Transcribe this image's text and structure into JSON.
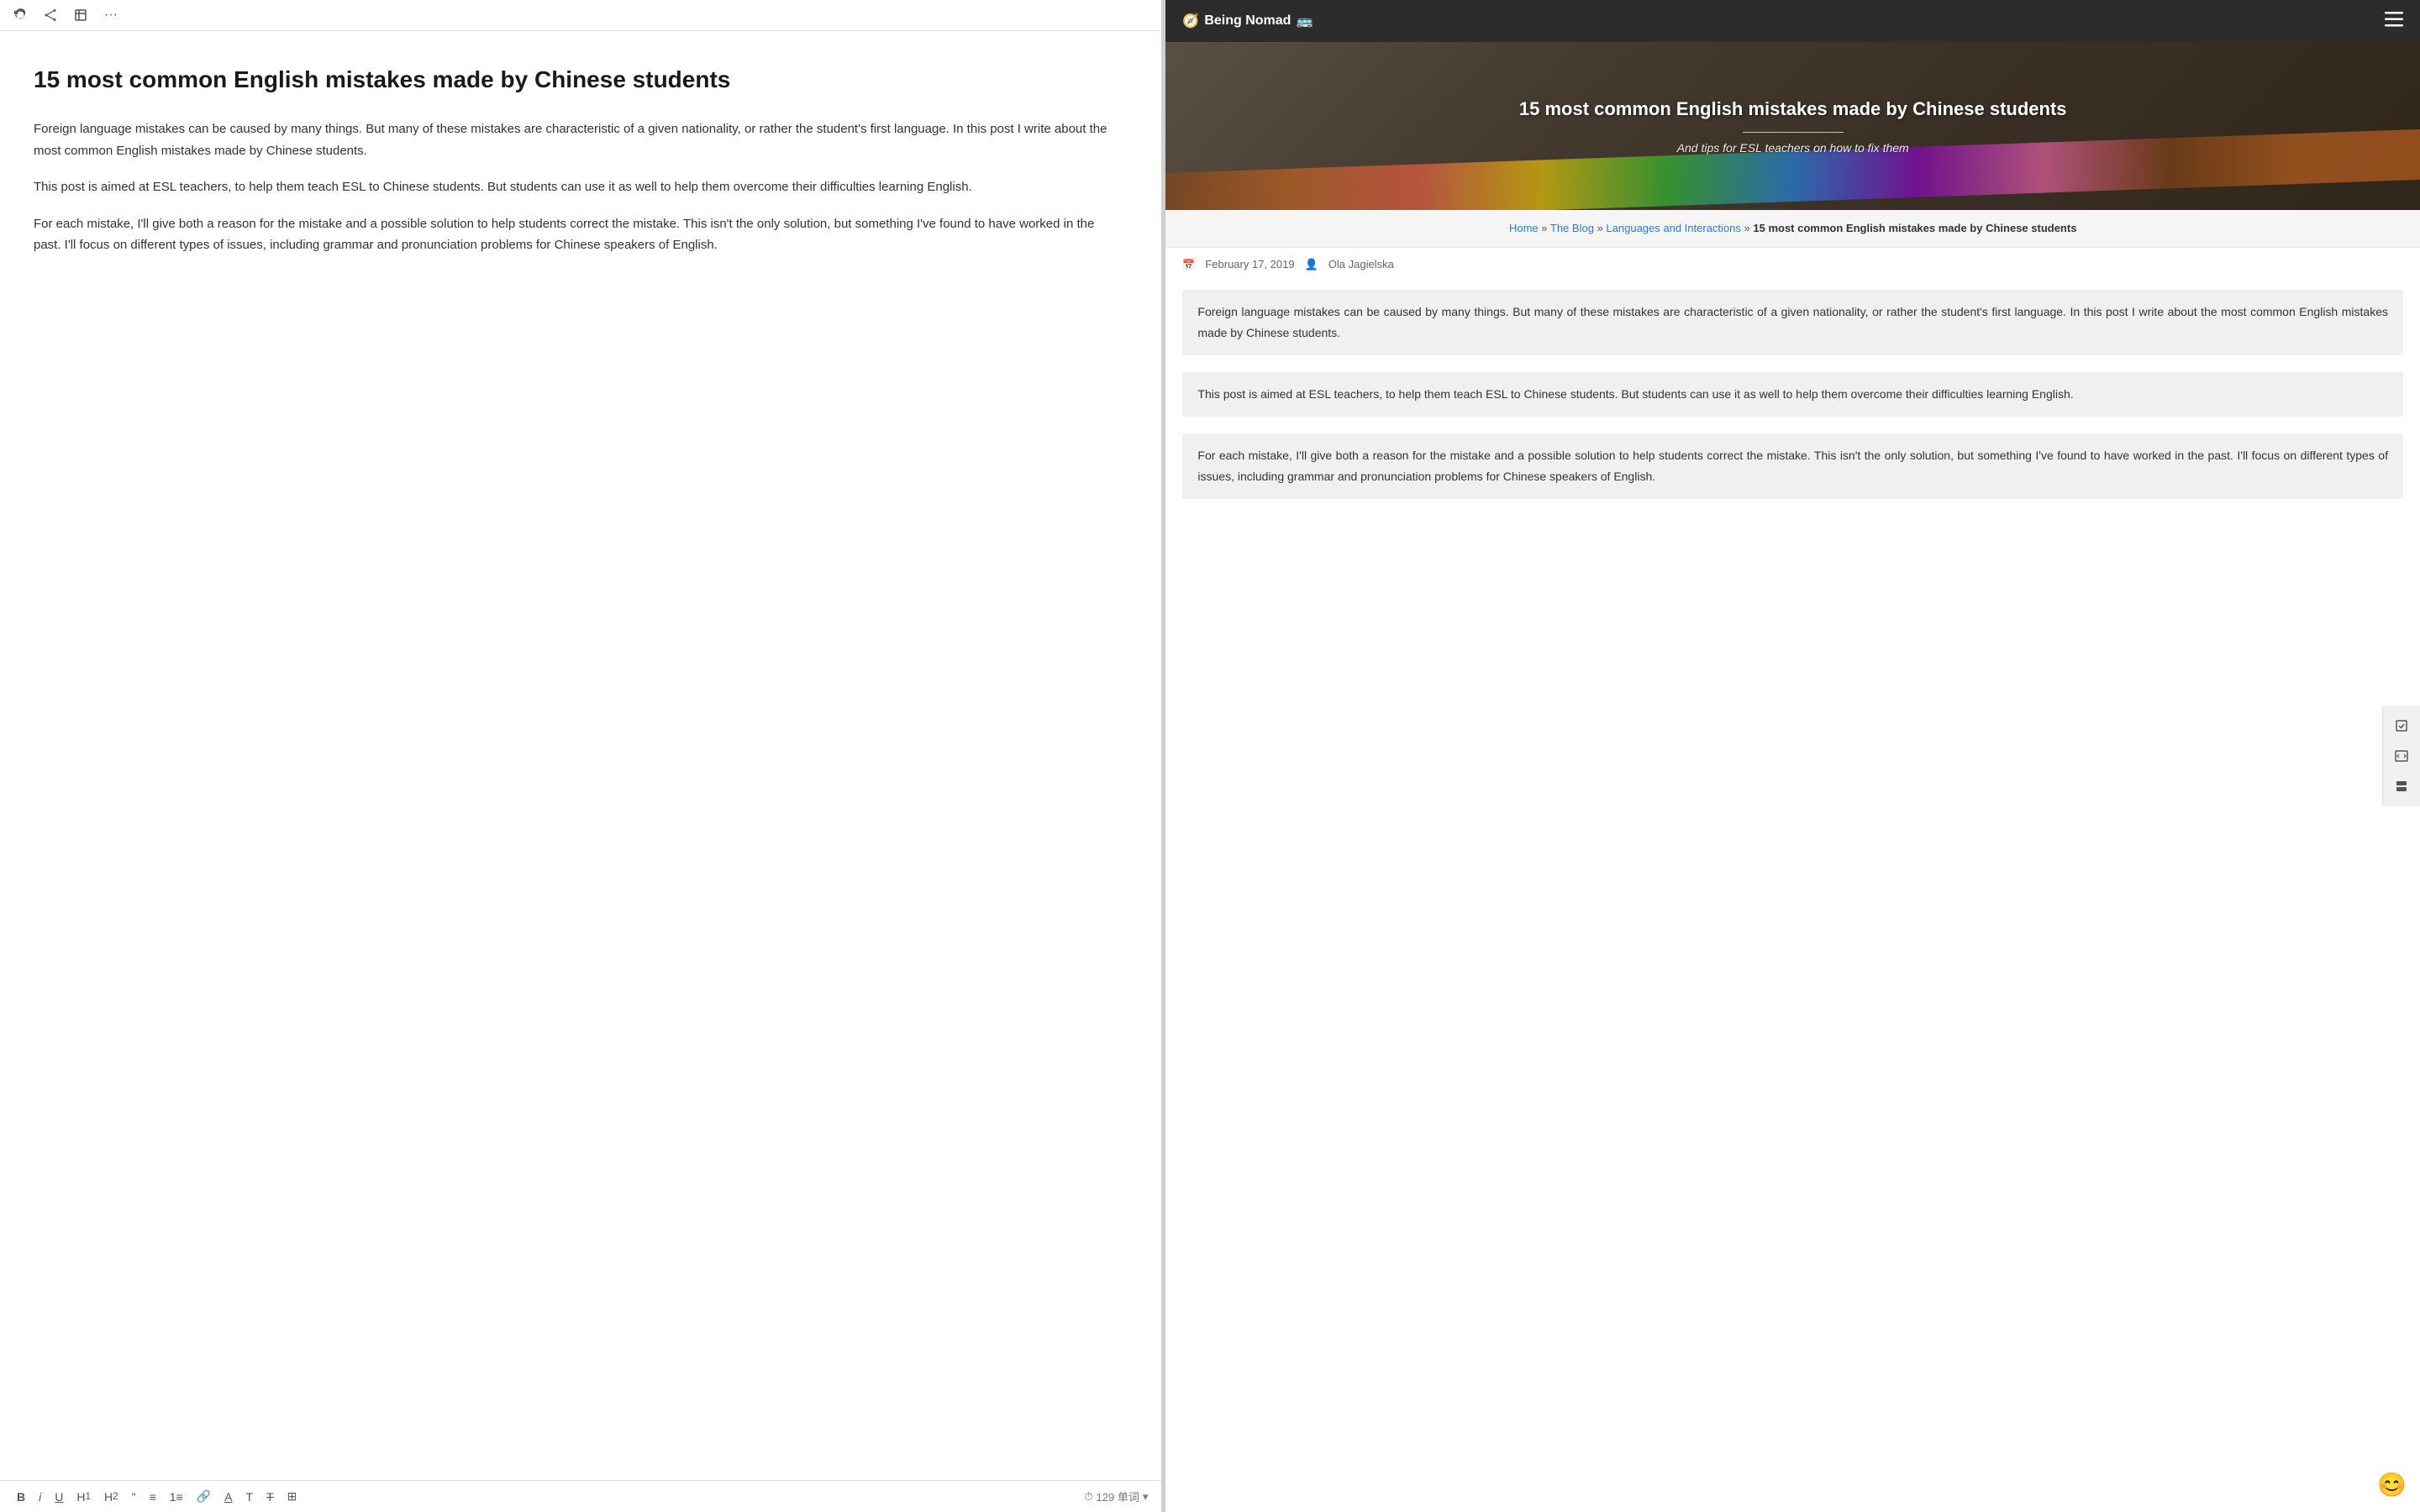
{
  "toolbar": {
    "refresh_icon": "↺",
    "share_icon": "⎘",
    "expand_icon": "⛶",
    "more_icon": "···"
  },
  "editor": {
    "title": "15 most common English mistakes made by Chinese students",
    "paragraphs": [
      "Foreign language mistakes can be caused by many things. But many of these mistakes are characteristic of a given nationality, or rather the student's first language. In this post I write about the most common English mistakes made by Chinese students.",
      "This post is aimed at ESL teachers, to help them teach ESL to Chinese students. But students can use it as well to help them overcome their difficulties learning English.",
      "For each mistake, I'll give both a reason for the mistake and a possible solution to help students correct the mistake. This isn't the only solution, but something I've found to have worked in the past. I'll focus on different types of issues, including grammar and pronunciation problems for Chinese speakers of English."
    ]
  },
  "bottom_toolbar": {
    "word_count_label": "129 单词",
    "clock_icon": "⏱"
  },
  "site": {
    "logo": "🧭 Being Nomad 🚌",
    "logo_text": "Being Nomad"
  },
  "hero": {
    "title": "15 most common English mistakes made by Chinese students",
    "divider": true,
    "subtitle": "And tips for ESL teachers on how to fix them"
  },
  "breadcrumb": {
    "home": "Home",
    "blog": "The Blog",
    "category": "Languages and Interactions",
    "current": "15 most common English mistakes made by Chinese students",
    "sep": "»"
  },
  "article": {
    "date": "February 17, 2019",
    "author": "Ola Jagielska",
    "paragraphs": [
      "Foreign language mistakes can be caused by many things. But many of these mistakes are characteristic of a given nationality, or rather the student's first language. In this post I write about the most common English mistakes made by Chinese students.",
      "This post is aimed at ESL teachers, to help them teach ESL to Chinese students. But students can use it as well to help them overcome their difficulties learning English.",
      "For each mistake, I'll give both a reason for the mistake and a possible solution to help students correct the mistake. This isn't the only solution, but something I've found to have worked in the past. I'll focus on different types of issues, including grammar and pronunciation problems for Chinese speakers of English."
    ]
  },
  "side_tools": {
    "check_icon": "☑",
    "code_icon": "◫",
    "stack_icon": "⊞"
  },
  "emoji": "😊"
}
